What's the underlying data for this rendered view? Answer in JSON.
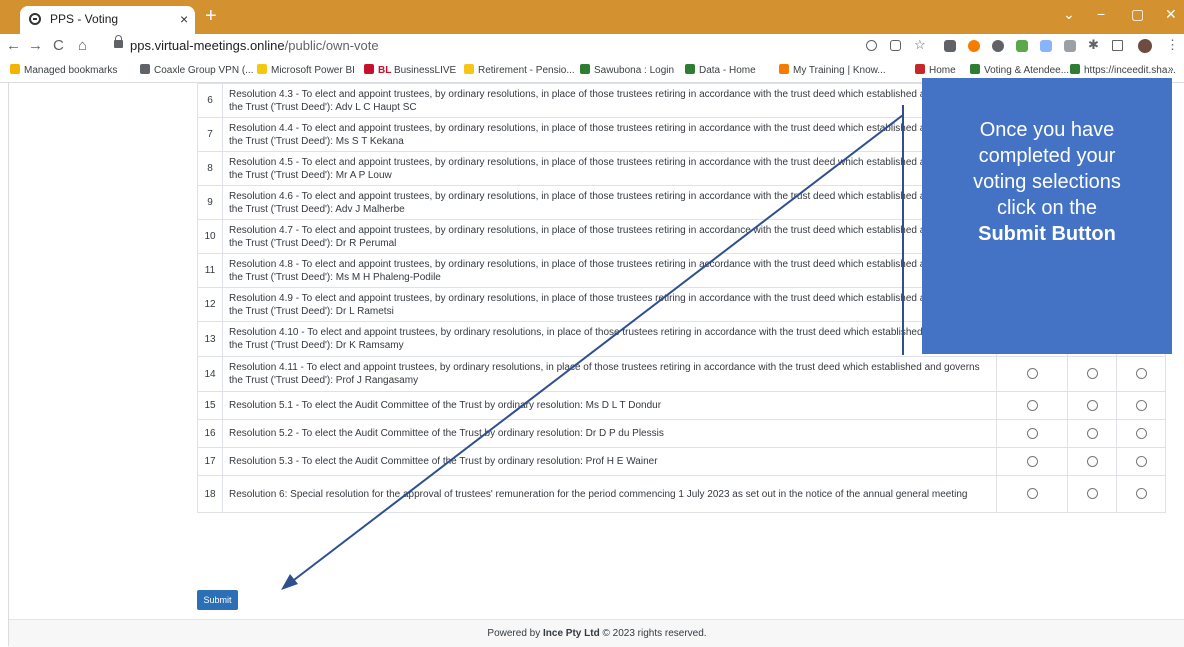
{
  "browser": {
    "tab_title": "PPS - Voting",
    "tab_close": "×",
    "new_tab": "+",
    "window_controls": [
      "⌄",
      "−",
      "▢",
      "✕"
    ],
    "nav": {
      "back": "←",
      "forward": "→",
      "reload": "C",
      "home": "⌂"
    },
    "url_host": "pps.virtual-meetings.online",
    "url_path": "/public/own-vote",
    "bookmarks": [
      {
        "label": "Managed bookmarks",
        "icon": "folder-icon",
        "color": "#f2b400"
      },
      {
        "label": "Coaxle Group VPN (...",
        "icon": "globe-icon",
        "color": "#5f6368"
      },
      {
        "label": "Microsoft Power BI",
        "icon": "power-bi-icon",
        "color": "#f2c811"
      },
      {
        "label": "BusinessLIVE",
        "icon": "bl-icon",
        "color": "#c8102e",
        "badge": "BL"
      },
      {
        "label": "Retirement - Pensio...",
        "icon": "sun-icon",
        "color": "#f5c518"
      },
      {
        "label": "Sawubona : Login",
        "icon": "sawubona-icon",
        "color": "#2e7d32"
      },
      {
        "label": "Data - Home",
        "icon": "data-home-icon",
        "color": "#2e7d32"
      },
      {
        "label": "My Training | Know...",
        "icon": "training-icon",
        "color": "#f57c00"
      },
      {
        "label": "Home",
        "icon": "home-bookmark-icon",
        "color": "#c62828"
      },
      {
        "label": "Voting & Atendee...",
        "icon": "voting-bookmark-icon",
        "color": "#2e7d32"
      },
      {
        "label": "https://inceedit.sha...",
        "icon": "share-icon",
        "color": "#2e7d32"
      },
      {
        "label": "»",
        "icon": "more-icon",
        "color": "#5f6368"
      }
    ]
  },
  "resolutions": [
    {
      "num": "6",
      "text": "Resolution 4.3 - To elect and appoint trustees, by ordinary resolutions, in place of those trustees retiring in accordance with the trust deed which established and governs the Trust ('Trust Deed'): Adv L C Haupt SC"
    },
    {
      "num": "7",
      "text": "Resolution 4.4 - To elect and appoint trustees, by ordinary resolutions, in place of those trustees retiring in accordance with the trust deed which established and governs the Trust ('Trust Deed'): Ms S T Kekana"
    },
    {
      "num": "8",
      "text": "Resolution 4.5 - To elect and appoint trustees, by ordinary resolutions, in place of those trustees retiring in accordance with the trust deed which established and governs the Trust ('Trust Deed'): Mr A P Louw"
    },
    {
      "num": "9",
      "text": "Resolution 4.6 - To elect and appoint trustees, by ordinary resolutions, in place of those trustees retiring in accordance with the trust deed which established and governs the Trust ('Trust Deed'): Adv J Malherbe"
    },
    {
      "num": "10",
      "text": "Resolution 4.7 - To elect and appoint trustees, by ordinary resolutions, in place of those trustees retiring in accordance with the trust deed which established and governs the Trust ('Trust Deed'): Dr R Perumal"
    },
    {
      "num": "11",
      "text": "Resolution 4.8 - To elect and appoint trustees, by ordinary resolutions, in place of those trustees retiring in accordance with the trust deed which established and governs the Trust ('Trust Deed'): Ms M H Phaleng-Podile"
    },
    {
      "num": "12",
      "text": "Resolution 4.9 - To elect and appoint trustees, by ordinary resolutions, in place of those trustees retiring in accordance with the trust deed which established and governs the Trust ('Trust Deed'): Dr L Rametsi"
    },
    {
      "num": "13",
      "text": "Resolution 4.10 - To elect and appoint trustees, by ordinary resolutions, in place of those trustees retiring in accordance with the trust deed which established and governs the Trust ('Trust Deed'): Dr K Ramsamy"
    },
    {
      "num": "14",
      "text": "Resolution 4.11 - To elect and appoint trustees, by ordinary resolutions, in place of those trustees retiring in accordance with the trust deed which established and governs the Trust ('Trust Deed'): Prof J Rangasamy"
    },
    {
      "num": "15",
      "text": "Resolution 5.1 - To elect the Audit Committee of the Trust by ordinary resolution: Ms D L T Dondur"
    },
    {
      "num": "16",
      "text": "Resolution 5.2 - To elect the Audit Committee of the Trust by ordinary resolution: Dr D P du Plessis"
    },
    {
      "num": "17",
      "text": "Resolution 5.3 - To elect the Audit Committee of the Trust by ordinary resolution: Prof H E Wainer"
    },
    {
      "num": "18",
      "text": "Resolution 6: Special resolution for the approval of trustees' remuneration for the period commencing 1 July 2023 as set out in the notice of the annual general meeting"
    }
  ],
  "submit_label": "Submit",
  "footer": {
    "prefix": "Powered by ",
    "company": "Ince Pty Ltd",
    "suffix": " © 2023 rights reserved."
  },
  "callout": {
    "lines": [
      "Once you have",
      "completed your",
      "voting selections",
      "click on the"
    ],
    "bold_line": "Submit Button",
    "color": "#4472c4"
  },
  "colors": {
    "tabstrip": "#d3922f",
    "submit": "#2b6fb6",
    "arrow": "#2f4f8f"
  }
}
